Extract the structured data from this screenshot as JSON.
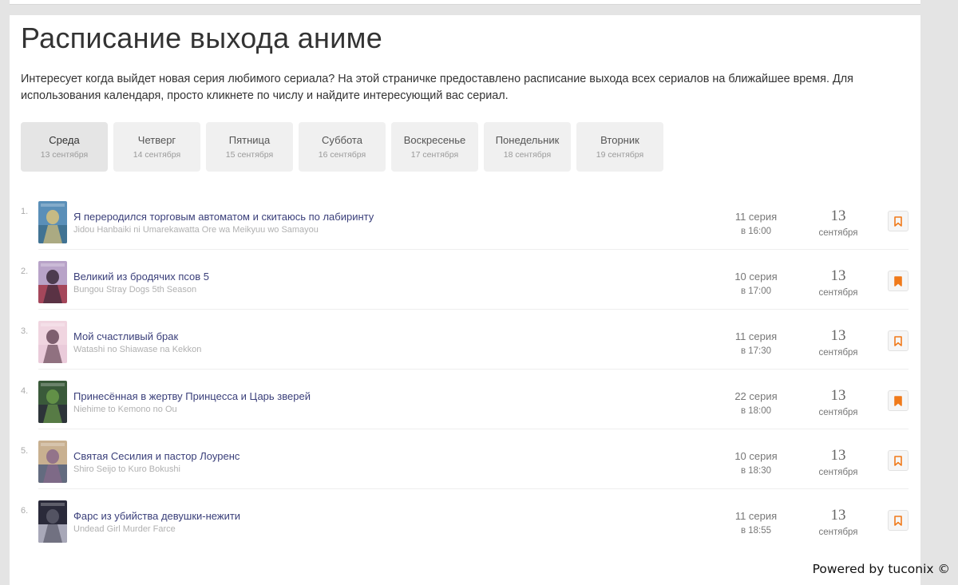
{
  "page": {
    "title": "Расписание выхода аниме",
    "intro": "Интересует когда выйдет новая серия любимого сериала? На этой страничке предоставлено расписание выхода всех сериалов на ближайшее время. Для использования календаря, просто кликнете по числу и найдите интересующий вас сериал."
  },
  "days": [
    {
      "name": "Среда",
      "date": "13 сентября",
      "active": true
    },
    {
      "name": "Четверг",
      "date": "14 сентября",
      "active": false
    },
    {
      "name": "Пятница",
      "date": "15 сентября",
      "active": false
    },
    {
      "name": "Суббота",
      "date": "16 сентября",
      "active": false
    },
    {
      "name": "Воскресенье",
      "date": "17 сентября",
      "active": false
    },
    {
      "name": "Понедельник",
      "date": "18 сентября",
      "active": false
    },
    {
      "name": "Вторник",
      "date": "19 сентября",
      "active": false
    }
  ],
  "schedule": [
    {
      "num": "1.",
      "title": "Я переродился торговым автоматом и скитаюсь по лабиринту",
      "original": "Jidou Hanbaiki ni Umarekawatta Ore wa Meikyuu wo Samayou",
      "episode": "11 серия",
      "time": "в 16:00",
      "day": "13",
      "month": "сентября",
      "bookmarked": false
    },
    {
      "num": "2.",
      "title": "Великий из бродячих псов 5",
      "original": "Bungou Stray Dogs 5th Season",
      "episode": "10 серия",
      "time": "в 17:00",
      "day": "13",
      "month": "сентября",
      "bookmarked": true
    },
    {
      "num": "3.",
      "title": "Мой счастливый брак",
      "original": "Watashi no Shiawase na Kekkon",
      "episode": "11 серия",
      "time": "в 17:30",
      "day": "13",
      "month": "сентября",
      "bookmarked": false
    },
    {
      "num": "4.",
      "title": "Принесённая в жертву Принцесса и Царь зверей",
      "original": "Niehime to Kemono no Ou",
      "episode": "22 серия",
      "time": "в 18:00",
      "day": "13",
      "month": "сентября",
      "bookmarked": true
    },
    {
      "num": "5.",
      "title": "Святая Сесилия и пастор Лоуренс",
      "original": "Shiro Seijo to Kuro Bokushi",
      "episode": "10 серия",
      "time": "в 18:30",
      "day": "13",
      "month": "сентября",
      "bookmarked": false
    },
    {
      "num": "6.",
      "title": "Фарс из убийства девушки-нежити",
      "original": "Undead Girl Murder Farce",
      "episode": "11 серия",
      "time": "в 18:55",
      "day": "13",
      "month": "сентября",
      "bookmarked": false
    }
  ],
  "posters": [
    [
      "#5a8fb8",
      "#d9c27a",
      "#3b6b8a"
    ],
    [
      "#b8a3c8",
      "#3a2a3a",
      "#a03040"
    ],
    [
      "#f0d5e0",
      "#6a4a5a",
      "#e8c8d8"
    ],
    [
      "#3a5a3a",
      "#6a9a4a",
      "#2a2a3a"
    ],
    [
      "#c8b090",
      "#8a6a8a",
      "#4a5a7a"
    ],
    [
      "#2a2a3a",
      "#5a5a6a",
      "#c8c8d8"
    ]
  ],
  "colors": {
    "accent": "#f07a1a",
    "link": "#3a3f7a"
  },
  "icons": {
    "bookmark_empty": "bookmark-outline-icon",
    "bookmark_filled": "bookmark-filled-icon"
  },
  "footer": {
    "powered": "Powered by tuconix ©"
  }
}
